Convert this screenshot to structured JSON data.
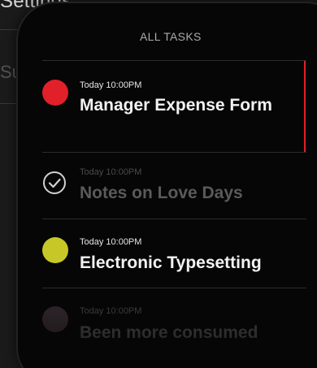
{
  "background": {
    "title": "Settings",
    "partial_text": "Sum"
  },
  "list": {
    "header": "ALL TASKS",
    "tasks": [
      {
        "time": "Today 10:00PM",
        "title": "Manager Expense Form",
        "status_color": "#e1202a",
        "state": "selected"
      },
      {
        "time": "Today 10:00PM",
        "title": "Notes on Love Days",
        "icon": "check-circle-icon",
        "state": "completed"
      },
      {
        "time": "Today 10:00PM",
        "title": "Electronic Typesetting",
        "status_color": "#c7c828",
        "state": "pending"
      },
      {
        "time": "Today 10:00PM",
        "title": "Been more consumed",
        "status_color": "#2a2226",
        "state": "faded"
      }
    ]
  }
}
